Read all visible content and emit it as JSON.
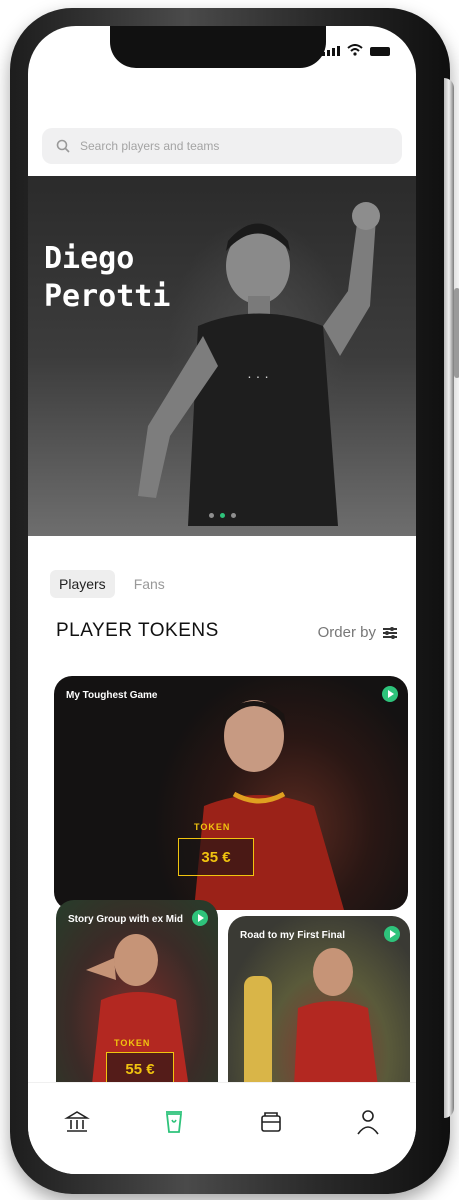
{
  "search": {
    "placeholder": "Search players and teams"
  },
  "hero": {
    "player_name": "Diego Perotti",
    "slide_count": 3,
    "active_slide": 1
  },
  "tabs": [
    {
      "label": "Players",
      "active": true
    },
    {
      "label": "Fans",
      "active": false
    }
  ],
  "section": {
    "title": "PLAYER TOKENS",
    "order_label": "Order by"
  },
  "cards": [
    {
      "title": "My Toughest Game",
      "token_label": "TOKEN",
      "price": "35 €",
      "icon": "play-icon"
    },
    {
      "title": "Story Group with ex Mid",
      "token_label": "TOKEN",
      "price": "55 €",
      "icon": "play-icon"
    },
    {
      "title": "Road to my First Final",
      "token_label": "",
      "price": "",
      "icon": "play-icon"
    }
  ],
  "nav": [
    {
      "name": "bank-icon",
      "active": false
    },
    {
      "name": "cup-icon",
      "active": true
    },
    {
      "name": "wallet-icon",
      "active": false
    },
    {
      "name": "profile-icon",
      "active": false
    }
  ],
  "colors": {
    "accent": "#2ec37b",
    "price": "#f1c40f"
  }
}
